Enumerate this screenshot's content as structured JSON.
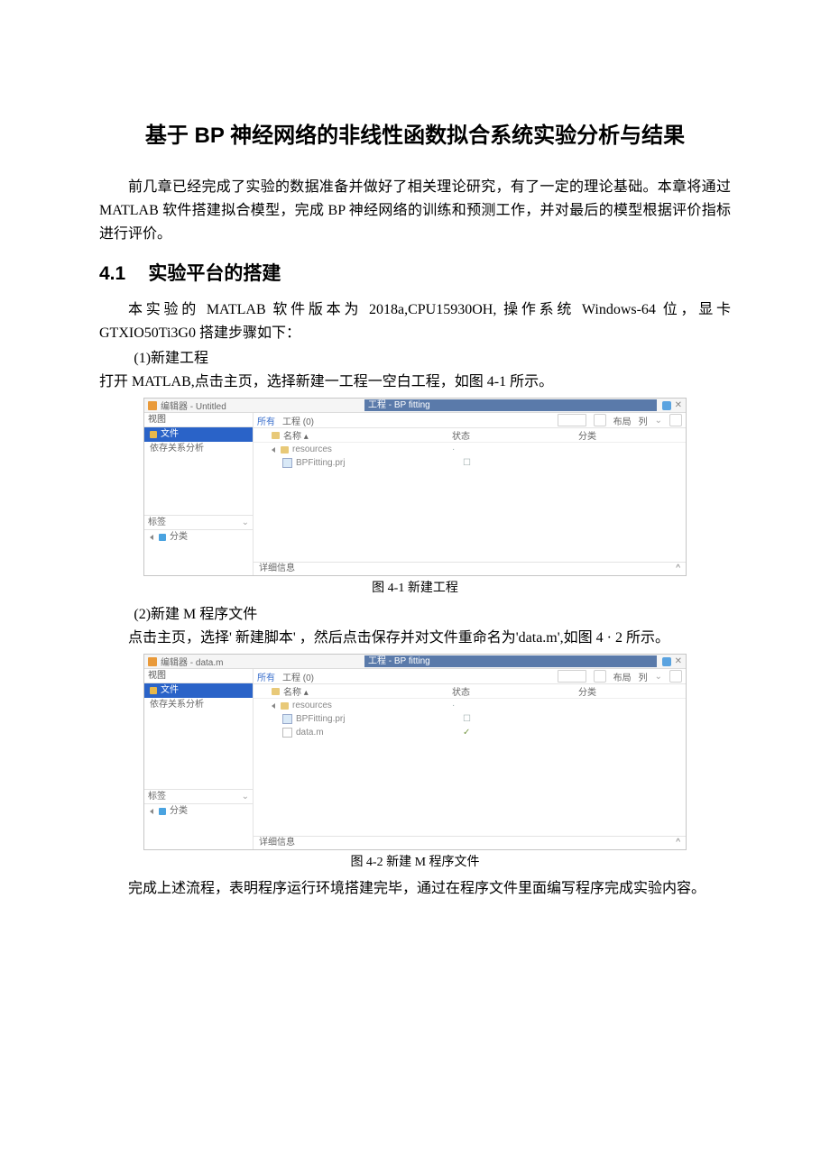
{
  "title": "基于 BP 神经网络的非线性函数拟合系统实验分析与结果",
  "intro": "前几章已经完成了实验的数据准备并做好了相关理论研究，有了一定的理论基础。本章将通过 MATLAB 软件搭建拟合模型，完成 BP 神经网络的训练和预测工作，并对最后的模型根据评价指标进行评价。",
  "section": {
    "num": "4.1",
    "title": "实验平台的搭建"
  },
  "platform_text": "本实验的 MATLAB 软件版本为 2018a,CPU15930OH, 操作系统 Windows-64 位，显卡 GTXIO50Ti3G0 搭建步骤如下：",
  "step1": {
    "label": "(1)新建工程",
    "desc": "打开 MATLAB,点击主页，选择新建一工程一空白工程，如图 4-1 所示。"
  },
  "step2": {
    "label": "(2)新建 M 程序文件",
    "desc": "点击主页，选择' 新建脚本' ，然后点击保存并对文件重命名为'data.m',如图 4 · 2 所示。"
  },
  "caption1": "图 4-1 新建工程",
  "caption2": "图 4-2 新建 M 程序文件",
  "closing": "完成上述流程，表明程序运行环境搭建完毕，通过在程序文件里面编写程序完成实验内容。",
  "shot": {
    "appname": "编辑器 - Untitled",
    "appname2": "编辑器 - data.m",
    "project": "工程 - BP fitting",
    "panel_view": "视图",
    "tree_files": "文件",
    "tree_dep": "依存关系分析",
    "panel_label": "标签",
    "panel_category": "分类",
    "tb_all": "所有",
    "tb_proj": "工程 (0)",
    "tb_layout": "布局",
    "tb_col": "列",
    "col_name": "名称 ▴",
    "col_status": "状态",
    "col_cat": "分类",
    "f_res": "resources",
    "f_prj": "BPFitting.prj",
    "f_data": "data.m",
    "status_text": "详细信息",
    "status_mark": "✓",
    "status_box": "☐",
    "dot": "·"
  }
}
